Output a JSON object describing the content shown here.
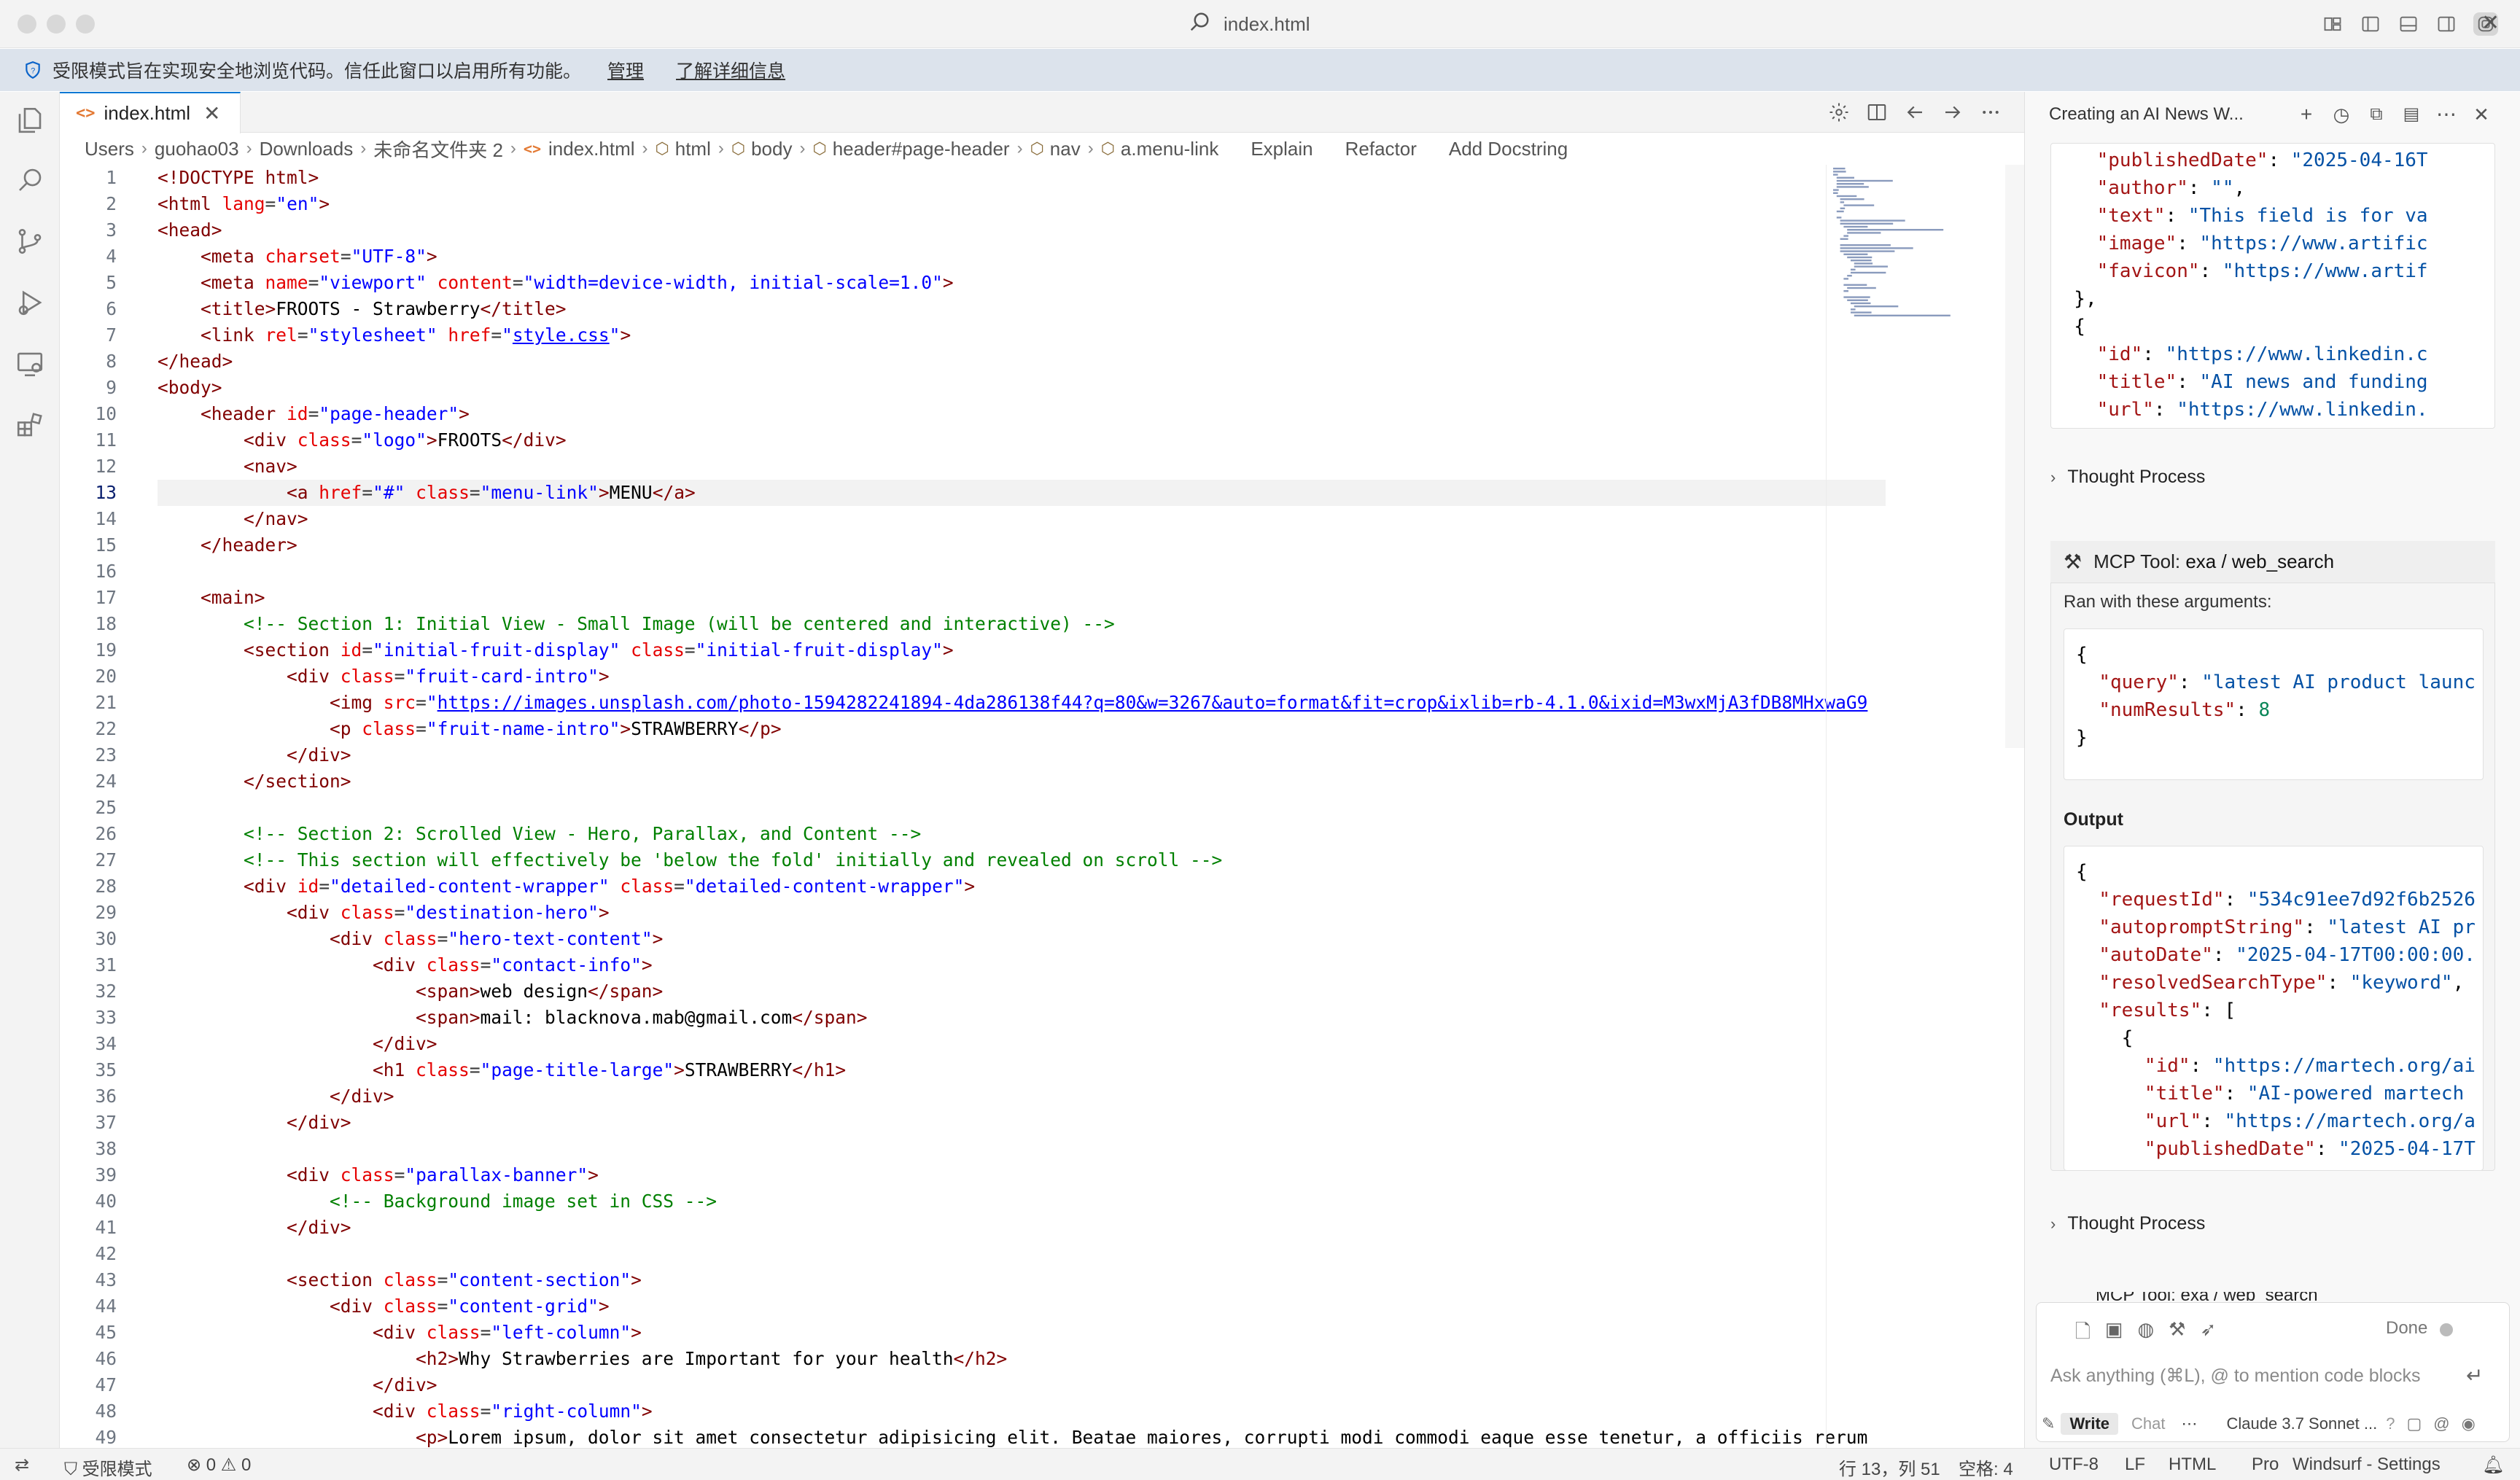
{
  "window": {
    "title": "index.html"
  },
  "banner": {
    "message": "受限模式旨在实现安全地浏览代码。信任此窗口以启用所有功能。",
    "manage_link": "管理",
    "learn_more_link": "了解详细信息"
  },
  "tabs": [
    {
      "label": "index.html",
      "active": true
    }
  ],
  "breadcrumb": {
    "items": [
      "Users",
      "guohao03",
      "Downloads",
      "未命名文件夹 2",
      "index.html",
      "html",
      "body",
      "header#page-header",
      "nav",
      "a.menu-link"
    ],
    "lenses": [
      "Explain",
      "Refactor",
      "Add Docstring"
    ]
  },
  "editor": {
    "current_line": 13,
    "lines": [
      {
        "n": "1",
        "html": "<span class='t-tag'>&lt;!DOCTYPE html&gt;</span>"
      },
      {
        "n": "2",
        "html": "<span class='t-tag'>&lt;html</span> <span class='t-attr'>lang</span>=<span class='t-val'>\"en\"</span><span class='t-tag'>&gt;</span>"
      },
      {
        "n": "3",
        "html": "<span class='t-tag'>&lt;head&gt;</span>"
      },
      {
        "n": "4",
        "html": "    <span class='t-tag'>&lt;meta</span> <span class='t-attr'>charset</span>=<span class='t-val'>\"UTF-8\"</span><span class='t-tag'>&gt;</span>"
      },
      {
        "n": "5",
        "html": "    <span class='t-tag'>&lt;meta</span> <span class='t-attr'>name</span>=<span class='t-val'>\"viewport\"</span> <span class='t-attr'>content</span>=<span class='t-val'>\"width=device-width, initial-scale=1.0\"</span><span class='t-tag'>&gt;</span>"
      },
      {
        "n": "6",
        "html": "    <span class='t-tag'>&lt;title&gt;</span><span class='t-txt'>FROOTS - Strawberry</span><span class='t-tag'>&lt;/title&gt;</span>"
      },
      {
        "n": "7",
        "html": "    <span class='t-tag'>&lt;link</span> <span class='t-attr'>rel</span>=<span class='t-val'>\"stylesheet\"</span> <span class='t-attr'>href</span>=<span class='t-val'>\"<span class='t-link'>style.css</span>\"</span><span class='t-tag'>&gt;</span>"
      },
      {
        "n": "8",
        "html": "<span class='t-tag'>&lt;/head&gt;</span>"
      },
      {
        "n": "9",
        "html": "<span class='t-tag'>&lt;body&gt;</span>"
      },
      {
        "n": "10",
        "html": "    <span class='t-tag'>&lt;header</span> <span class='t-attr'>id</span>=<span class='t-val'>\"page-header\"</span><span class='t-tag'>&gt;</span>"
      },
      {
        "n": "11",
        "html": "        <span class='t-tag'>&lt;div</span> <span class='t-attr'>class</span>=<span class='t-val'>\"logo\"</span><span class='t-tag'>&gt;</span><span class='t-txt'>FROOTS</span><span class='t-tag'>&lt;/div&gt;</span>"
      },
      {
        "n": "12",
        "html": "        <span class='t-tag'>&lt;nav&gt;</span>"
      },
      {
        "n": "13",
        "html": "            <span class='t-tag'>&lt;a</span> <span class='t-attr'>href</span>=<span class='t-val'>\"#\"</span> <span class='t-attr'>class</span>=<span class='t-val'>\"menu-link\"</span><span class='t-tag'>&gt;</span><span class='t-txt'>MENU</span><span class='t-tag'>&lt;/a&gt;</span>"
      },
      {
        "n": "14",
        "html": "        <span class='t-tag'>&lt;/nav&gt;</span>"
      },
      {
        "n": "15",
        "html": "    <span class='t-tag'>&lt;/header&gt;</span>"
      },
      {
        "n": "16",
        "html": ""
      },
      {
        "n": "17",
        "html": "    <span class='t-tag'>&lt;main&gt;</span>"
      },
      {
        "n": "18",
        "html": "        <span class='t-com'>&lt;!-- Section 1: Initial View - Small Image (will be centered and interactive) --&gt;</span>"
      },
      {
        "n": "19",
        "html": "        <span class='t-tag'>&lt;section</span> <span class='t-attr'>id</span>=<span class='t-val'>\"initial-fruit-display\"</span> <span class='t-attr'>class</span>=<span class='t-val'>\"initial-fruit-display\"</span><span class='t-tag'>&gt;</span>"
      },
      {
        "n": "20",
        "html": "            <span class='t-tag'>&lt;div</span> <span class='t-attr'>class</span>=<span class='t-val'>\"fruit-card-intro\"</span><span class='t-tag'>&gt;</span>"
      },
      {
        "n": "21",
        "html": "                <span class='t-tag'>&lt;img</span> <span class='t-attr'>src</span>=<span class='t-val'>\"<span class='t-link'>https://images.unsplash.com/photo-1594282241894-4da286138f44?q=80&amp;w=3267&amp;auto=format&amp;fit=crop&amp;ixlib=rb-4.1.0&amp;ixid=M3wxMjA3fDB8MHxwaG9</span></span>"
      },
      {
        "n": "22",
        "html": "                <span class='t-tag'>&lt;p</span> <span class='t-attr'>class</span>=<span class='t-val'>\"fruit-name-intro\"</span><span class='t-tag'>&gt;</span><span class='t-txt'>STRAWBERRY</span><span class='t-tag'>&lt;/p&gt;</span>"
      },
      {
        "n": "23",
        "html": "            <span class='t-tag'>&lt;/div&gt;</span>"
      },
      {
        "n": "24",
        "html": "        <span class='t-tag'>&lt;/section&gt;</span>"
      },
      {
        "n": "25",
        "html": ""
      },
      {
        "n": "26",
        "html": "        <span class='t-com'>&lt;!-- Section 2: Scrolled View - Hero, Parallax, and Content --&gt;</span>"
      },
      {
        "n": "27",
        "html": "        <span class='t-com'>&lt;!-- This section will effectively be 'below the fold' initially and revealed on scroll --&gt;</span>"
      },
      {
        "n": "28",
        "html": "        <span class='t-tag'>&lt;div</span> <span class='t-attr'>id</span>=<span class='t-val'>\"detailed-content-wrapper\"</span> <span class='t-attr'>class</span>=<span class='t-val'>\"detailed-content-wrapper\"</span><span class='t-tag'>&gt;</span>"
      },
      {
        "n": "29",
        "html": "            <span class='t-tag'>&lt;div</span> <span class='t-attr'>class</span>=<span class='t-val'>\"destination-hero\"</span><span class='t-tag'>&gt;</span>"
      },
      {
        "n": "30",
        "html": "                <span class='t-tag'>&lt;div</span> <span class='t-attr'>class</span>=<span class='t-val'>\"hero-text-content\"</span><span class='t-tag'>&gt;</span>"
      },
      {
        "n": "31",
        "html": "                    <span class='t-tag'>&lt;div</span> <span class='t-attr'>class</span>=<span class='t-val'>\"contact-info\"</span><span class='t-tag'>&gt;</span>"
      },
      {
        "n": "32",
        "html": "                        <span class='t-tag'>&lt;span&gt;</span><span class='t-txt'>web design</span><span class='t-tag'>&lt;/span&gt;</span>"
      },
      {
        "n": "33",
        "html": "                        <span class='t-tag'>&lt;span&gt;</span><span class='t-txt'>mail: blacknova.mab@gmail.com</span><span class='t-tag'>&lt;/span&gt;</span>"
      },
      {
        "n": "34",
        "html": "                    <span class='t-tag'>&lt;/div&gt;</span>"
      },
      {
        "n": "35",
        "html": "                    <span class='t-tag'>&lt;h1</span> <span class='t-attr'>class</span>=<span class='t-val'>\"page-title-large\"</span><span class='t-tag'>&gt;</span><span class='t-txt'>STRAWBERRY</span><span class='t-tag'>&lt;/h1&gt;</span>"
      },
      {
        "n": "36",
        "html": "                <span class='t-tag'>&lt;/div&gt;</span>"
      },
      {
        "n": "37",
        "html": "            <span class='t-tag'>&lt;/div&gt;</span>"
      },
      {
        "n": "38",
        "html": ""
      },
      {
        "n": "39",
        "html": "            <span class='t-tag'>&lt;div</span> <span class='t-attr'>class</span>=<span class='t-val'>\"parallax-banner\"</span><span class='t-tag'>&gt;</span>"
      },
      {
        "n": "40",
        "html": "                <span class='t-com'>&lt;!-- Background image set in CSS --&gt;</span>"
      },
      {
        "n": "41",
        "html": "            <span class='t-tag'>&lt;/div&gt;</span>"
      },
      {
        "n": "42",
        "html": ""
      },
      {
        "n": "43",
        "html": "            <span class='t-tag'>&lt;section</span> <span class='t-attr'>class</span>=<span class='t-val'>\"content-section\"</span><span class='t-tag'>&gt;</span>"
      },
      {
        "n": "44",
        "html": "                <span class='t-tag'>&lt;div</span> <span class='t-attr'>class</span>=<span class='t-val'>\"content-grid\"</span><span class='t-tag'>&gt;</span>"
      },
      {
        "n": "45",
        "html": "                    <span class='t-tag'>&lt;div</span> <span class='t-attr'>class</span>=<span class='t-val'>\"left-column\"</span><span class='t-tag'>&gt;</span>"
      },
      {
        "n": "46",
        "html": "                        <span class='t-tag'>&lt;h2&gt;</span><span class='t-txt'>Why Strawberries are Important for your health</span><span class='t-tag'>&lt;/h2&gt;</span>"
      },
      {
        "n": "47",
        "html": "                    <span class='t-tag'>&lt;/div&gt;</span>"
      },
      {
        "n": "48",
        "html": "                    <span class='t-tag'>&lt;div</span> <span class='t-attr'>class</span>=<span class='t-val'>\"right-column\"</span><span class='t-tag'>&gt;</span>"
      },
      {
        "n": "49",
        "html": "                        <span class='t-tag'>&lt;p&gt;</span><span class='t-txt'>Lorem ipsum, dolor sit amet consectetur adipisicing elit. Beatae maiores, corrupti modi commodi eaque esse tenetur, a officiis rerum</span>"
      }
    ]
  },
  "panel": {
    "title": "Creating an AI News W...",
    "top_json_lines": [
      {
        "html": "    <span class='k'>\"publishedDate\"</span>: <span class='s'>\"2025-04-16T</span>"
      },
      {
        "html": "    <span class='k'>\"author\"</span>: <span class='s'>\"\"</span>,"
      },
      {
        "html": "    <span class='k'>\"text\"</span>: <span class='s'>\"This field is for va</span>"
      },
      {
        "html": "    <span class='k'>\"image\"</span>: <span class='s'>\"https://www.artific</span>"
      },
      {
        "html": "    <span class='k'>\"favicon\"</span>: <span class='s'>\"https://www.artif</span>"
      },
      {
        "html": "  },"
      },
      {
        "html": "  {"
      },
      {
        "html": "    <span class='k'>\"id\"</span>: <span class='s'>\"https://www.linkedin.c</span>"
      },
      {
        "html": "    <span class='k'>\"title\"</span>: <span class='s'>\"AI news and funding</span>"
      },
      {
        "html": "    <span class='k'>\"url\"</span>: <span class='s'>\"https://www.linkedin.</span>"
      }
    ],
    "thought_process_label": "Thought Process",
    "tool": {
      "label_prefix": "MCP Tool: ",
      "name": "exa / web_search",
      "args_label": "Ran with these arguments:",
      "args_lines": [
        {
          "html": "{"
        },
        {
          "html": "  <span class='k'>\"query\"</span>: <span class='s'>\"latest AI product launc</span>"
        },
        {
          "html": "  <span class='k'>\"numResults\"</span>: <span class='n'>8</span>"
        },
        {
          "html": "}"
        }
      ],
      "output_label": "Output",
      "output_lines": [
        {
          "html": "{"
        },
        {
          "html": "  <span class='k'>\"requestId\"</span>: <span class='s'>\"534c91ee7d92f6b2526</span>"
        },
        {
          "html": "  <span class='k'>\"autopromptString\"</span>: <span class='s'>\"latest AI pr</span>"
        },
        {
          "html": "  <span class='k'>\"autoDate\"</span>: <span class='s'>\"2025-04-17T00:00:00.</span>"
        },
        {
          "html": "  <span class='k'>\"resolvedSearchType\"</span>: <span class='s'>\"keyword\"</span>,"
        },
        {
          "html": "  <span class='k'>\"results\"</span>: ["
        },
        {
          "html": "    {"
        },
        {
          "html": "      <span class='k'>\"id\"</span>: <span class='s'>\"https://martech.org/ai</span>"
        },
        {
          "html": "      <span class='k'>\"title\"</span>: <span class='s'>\"AI-powered martech</span>"
        },
        {
          "html": "      <span class='k'>\"url\"</span>: <span class='s'>\"https://martech.org/a</span>"
        },
        {
          "html": "      <span class='k'>\"publishedDate\"</span>: <span class='s'>\"2025-04-17T</span>"
        }
      ]
    },
    "next_tool_partial": "MCP Tool: exa / web_search"
  },
  "chat": {
    "done_label": "Done",
    "placeholder": "Ask anything (⌘L), @ to mention code blocks",
    "mode_write": "Write",
    "mode_chat": "Chat",
    "model": "Claude 3.7 Sonnet ..."
  },
  "statusbar": {
    "restricted_mode": "受限模式",
    "errors": "0",
    "warnings": "0",
    "position": "行 13，列 51",
    "indent": "空格: 4",
    "encoding": "UTF-8",
    "eol": "LF",
    "language": "HTML",
    "plan": "Pro",
    "settings": "Windsurf - Settings"
  },
  "colors": {
    "accent": "#0078d4",
    "banner_bg": "#dce3ec",
    "html_tag": "#800000",
    "html_attr": "#e50000",
    "html_value": "#0000ff",
    "comment": "#008000"
  }
}
